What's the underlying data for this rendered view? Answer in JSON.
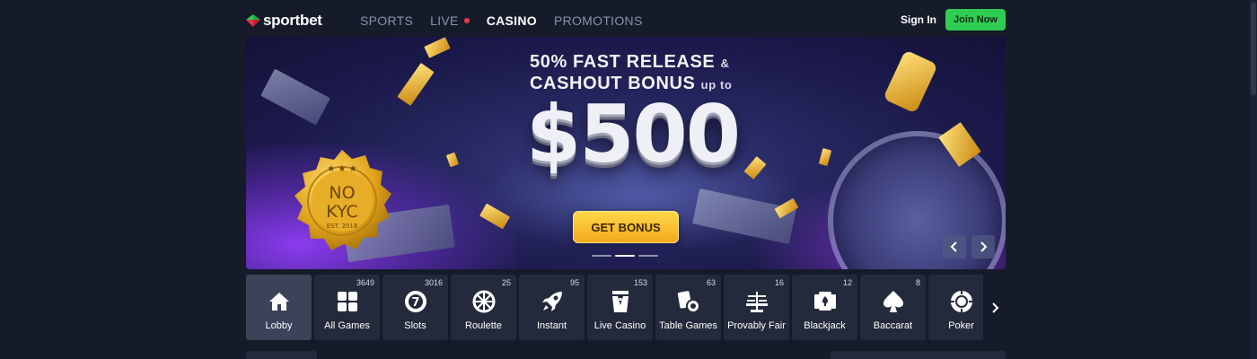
{
  "header": {
    "logo_text": "sportbet",
    "nav": [
      {
        "label": "SPORTS",
        "active": false
      },
      {
        "label": "LIVE",
        "active": false,
        "live_dot": true
      },
      {
        "label": "CASINO",
        "active": true
      },
      {
        "label": "PROMOTIONS",
        "active": false
      }
    ],
    "sign_in": "Sign In",
    "join_now": "Join Now"
  },
  "banner": {
    "line1": "50% FAST RELEASE",
    "line1_amp": "&",
    "line2": "CASHOUT BONUS",
    "line2_small": "up to",
    "amount": "$500",
    "cta": "GET BONUS",
    "badge_line1": "NO",
    "badge_line2": "KYC",
    "badge_est": "EST. 2018",
    "slides_total": 3,
    "slide_active": 2
  },
  "categories": [
    {
      "label": "Lobby",
      "count": "",
      "icon": "home-icon",
      "active": true
    },
    {
      "label": "All Games",
      "count": "3649",
      "icon": "grid-icon"
    },
    {
      "label": "Slots",
      "count": "3016",
      "icon": "slot-seven-icon"
    },
    {
      "label": "Roulette",
      "count": "25",
      "icon": "roulette-wheel-icon"
    },
    {
      "label": "Instant",
      "count": "95",
      "icon": "rocket-icon"
    },
    {
      "label": "Live Casino",
      "count": "153",
      "icon": "dealer-icon"
    },
    {
      "label": "Table Games",
      "count": "63",
      "icon": "cards-chip-icon"
    },
    {
      "label": "Provably Fair",
      "count": "16",
      "icon": "scale-icon"
    },
    {
      "label": "Blackjack",
      "count": "12",
      "icon": "playing-cards-icon"
    },
    {
      "label": "Baccarat",
      "count": "8",
      "icon": "spade-icon"
    },
    {
      "label": "Poker",
      "count": "5",
      "icon": "poker-chip-icon"
    }
  ],
  "colors": {
    "background": "#151b29",
    "tile": "#232a3b",
    "tile_active": "#3a4358",
    "join_button": "#2ecc52",
    "live_dot": "#f0334a",
    "cta_gold": "#f5b52a"
  }
}
